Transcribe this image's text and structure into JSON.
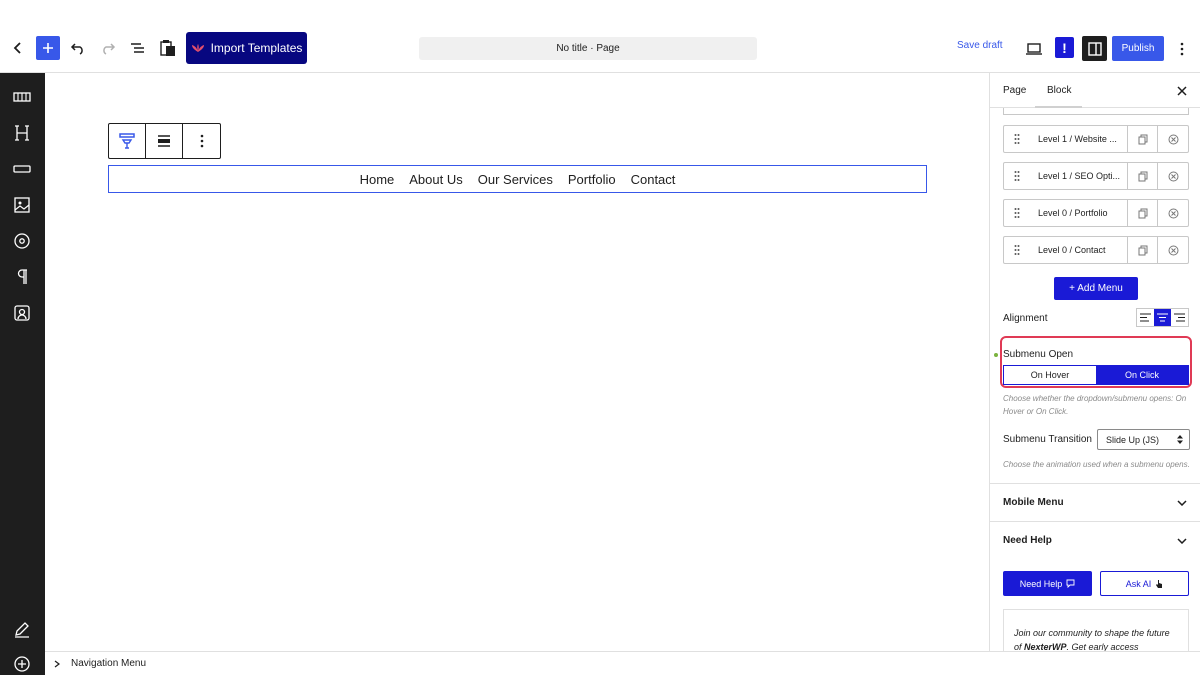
{
  "toolbar": {
    "import_label": "Import Templates",
    "doc_title": "No title · Page",
    "save_draft": "Save draft",
    "publish": "Publish",
    "excl": "!"
  },
  "nav_block": {
    "items": [
      "Home",
      "About Us",
      "Our Services",
      "Portfolio",
      "Contact"
    ]
  },
  "statusbar": {
    "breadcrumb": "Navigation Menu"
  },
  "panel": {
    "tabs": [
      "Page",
      "Block"
    ],
    "menu_items": [
      "Level 1 / Website ...",
      "Level 1 / SEO Opti...",
      "Level 0 / Portfolio",
      "Level 0 / Contact"
    ],
    "add_menu": "+ Add Menu",
    "alignment_label": "Alignment",
    "submenu_open_label": "Submenu Open",
    "submenu_options": [
      "On Hover",
      "On Click"
    ],
    "submenu_selected": "On Click",
    "submenu_open_help": "Choose whether the dropdown/submenu opens: On Hover or On Click.",
    "submenu_transition_label": "Submenu Transition",
    "submenu_transition_value": "Slide Up (JS)",
    "submenu_transition_help": "Choose the animation used when a submenu opens.",
    "mobile_menu": "Mobile Menu",
    "need_help_section": "Need Help",
    "need_help_btn": "Need Help",
    "ask_ai_btn": "Ask AI",
    "community_pre": "Join our community to shape the future of ",
    "community_brand": "NexterWP",
    "community_post": ". Get early access"
  },
  "colors": {
    "accent": "#1a1ad6",
    "wp_blue": "#3858e9",
    "import_bg": "#070780",
    "highlight": "#e03a55"
  }
}
